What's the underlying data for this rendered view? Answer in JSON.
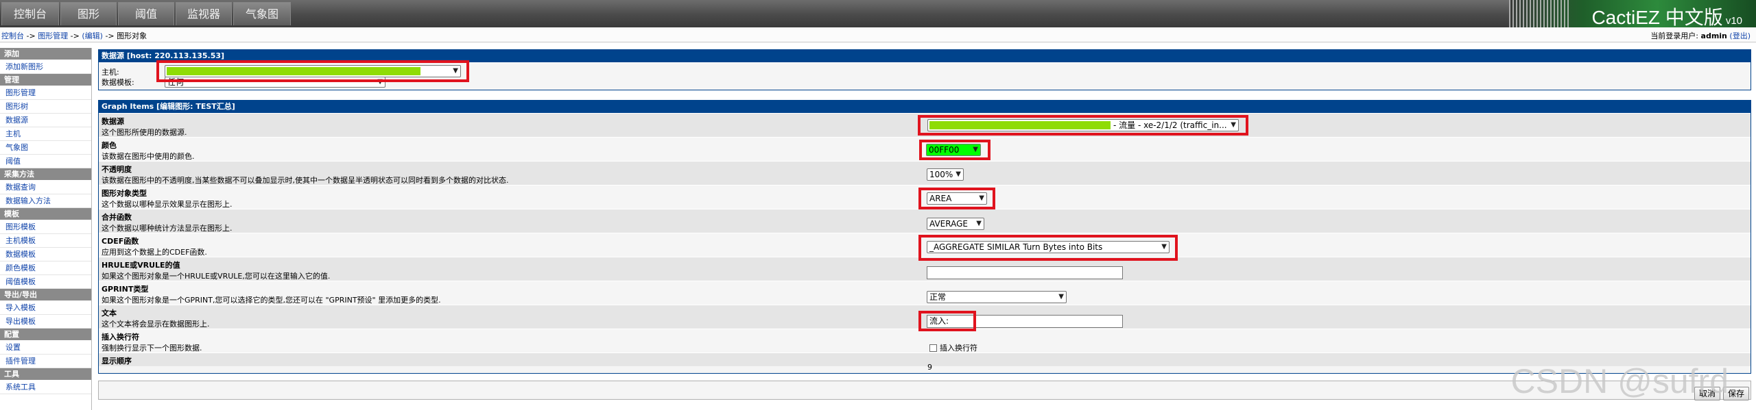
{
  "nav": {
    "tabs": [
      "控制台",
      "图形",
      "阈值",
      "监视器",
      "气象图"
    ],
    "brand": "CactiEZ 中文版",
    "brand_version": "v10"
  },
  "breadcrumb": {
    "items": [
      "控制台",
      "图形管理",
      "(编辑)",
      "图形对象"
    ],
    "separator": " -> "
  },
  "login": {
    "label": "当前登录用户:",
    "user": "admin",
    "logout": "(登出)"
  },
  "sidebar": {
    "sections": [
      {
        "title": "添加",
        "items": [
          "添加新图形"
        ]
      },
      {
        "title": "管理",
        "items": [
          "图形管理",
          "图形树",
          "数据源",
          "主机",
          "气象图",
          "阈值"
        ]
      },
      {
        "title": "采集方法",
        "items": [
          "数据查询",
          "数据输入方法"
        ]
      },
      {
        "title": "模板",
        "items": [
          "图形模板",
          "主机模板",
          "数据模板",
          "颜色模板",
          "阈值模板"
        ]
      },
      {
        "title": "导出/导出",
        "items": [
          "导入模板",
          "导出模板"
        ]
      },
      {
        "title": "配置",
        "items": [
          "设置",
          "插件管理"
        ]
      },
      {
        "title": "工具",
        "items": [
          "系统工具"
        ]
      }
    ]
  },
  "datasource_panel": {
    "header": "数据源 [host: 220.113.135.53]",
    "host_label": "主机:",
    "host_value": "",
    "template_label": "数据模板:",
    "template_value": "任何"
  },
  "graph_items_panel": {
    "header": "Graph Items [编辑图形: TEST汇总]",
    "rows": {
      "datasource": {
        "title": "数据源",
        "desc": "这个图形所使用的数据源.",
        "value": "- 流量 - xe-2/1/2 (traffic_in..."
      },
      "color": {
        "title": "颜色",
        "desc": "该数据在图形中使用的颜色.",
        "value": "00FF00"
      },
      "opacity": {
        "title": "不透明度",
        "desc": "该数据在图形中的不透明度,当某些数据不可以叠加显示时,使其中一个数据呈半透明状态可以同时看到多个数据的对比状态.",
        "value": "100%"
      },
      "item_type": {
        "title": "图形对象类型",
        "desc": "这个数据以哪种显示效果显示在图形上.",
        "value": "AREA"
      },
      "cf": {
        "title": "合并函数",
        "desc": "这个数据以哪种统计方法显示在图形上.",
        "value": "AVERAGE"
      },
      "cdef": {
        "title": "CDEF函数",
        "desc": "应用到这个数据上的CDEF函数.",
        "value": "_AGGREGATE SIMILAR Turn Bytes into Bits"
      },
      "hrule": {
        "title": "HRULE或VRULE的值",
        "desc": "如果这个图形对象是一个HRULE或VRULE,您可以在这里输入它的值.",
        "value": ""
      },
      "gprint": {
        "title": "GPRINT类型",
        "desc": "如果这个图形对象是一个GPRINT,您可以选择它的类型,您还可以在 \"GPRINT预设\" 里添加更多的类型.",
        "value": "正常"
      },
      "text": {
        "title": "文本",
        "desc": "这个文本将会显示在数据图形上.",
        "value": "流入:"
      },
      "hard_return": {
        "title": "插入换行符",
        "desc": "强制换行显示下一个图形数据.",
        "checkbox_label": "插入换行符"
      },
      "sequence": {
        "title": "显示顺序",
        "value": "9"
      }
    }
  },
  "buttons": {
    "cancel": "取消",
    "save": "保存"
  },
  "watermark": "CSDN @sufrd",
  "colors": {
    "panel_header": "#00438c",
    "highlight": "#e0131e",
    "redacted": "#8fdc05",
    "brand_green": "#2d8a3c"
  }
}
